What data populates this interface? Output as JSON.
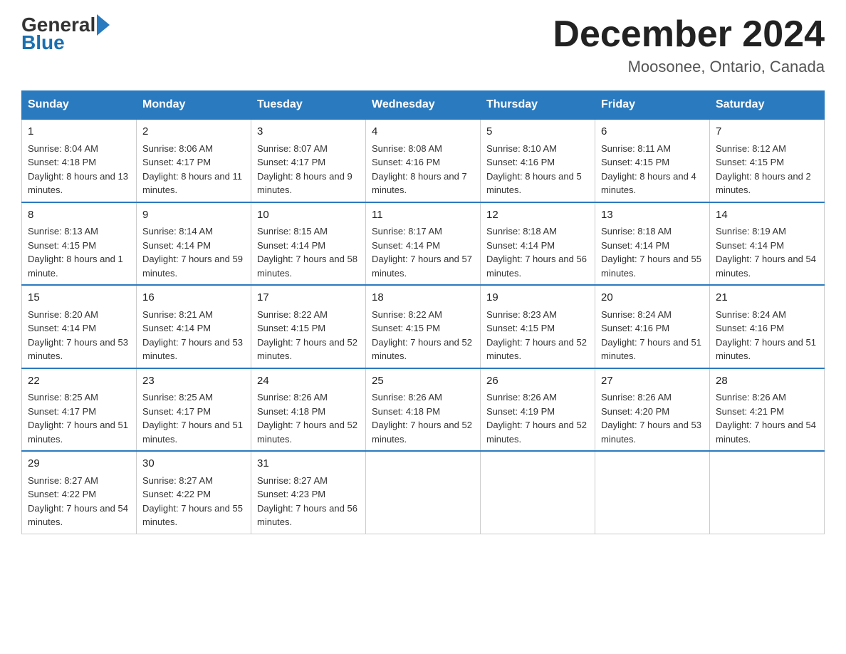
{
  "header": {
    "logo_general": "General",
    "logo_blue": "Blue",
    "title": "December 2024",
    "location": "Moosonee, Ontario, Canada"
  },
  "weekdays": [
    "Sunday",
    "Monday",
    "Tuesday",
    "Wednesday",
    "Thursday",
    "Friday",
    "Saturday"
  ],
  "weeks": [
    [
      {
        "day": "1",
        "sunrise": "8:04 AM",
        "sunset": "4:18 PM",
        "daylight": "8 hours and 13 minutes."
      },
      {
        "day": "2",
        "sunrise": "8:06 AM",
        "sunset": "4:17 PM",
        "daylight": "8 hours and 11 minutes."
      },
      {
        "day": "3",
        "sunrise": "8:07 AM",
        "sunset": "4:17 PM",
        "daylight": "8 hours and 9 minutes."
      },
      {
        "day": "4",
        "sunrise": "8:08 AM",
        "sunset": "4:16 PM",
        "daylight": "8 hours and 7 minutes."
      },
      {
        "day": "5",
        "sunrise": "8:10 AM",
        "sunset": "4:16 PM",
        "daylight": "8 hours and 5 minutes."
      },
      {
        "day": "6",
        "sunrise": "8:11 AM",
        "sunset": "4:15 PM",
        "daylight": "8 hours and 4 minutes."
      },
      {
        "day": "7",
        "sunrise": "8:12 AM",
        "sunset": "4:15 PM",
        "daylight": "8 hours and 2 minutes."
      }
    ],
    [
      {
        "day": "8",
        "sunrise": "8:13 AM",
        "sunset": "4:15 PM",
        "daylight": "8 hours and 1 minute."
      },
      {
        "day": "9",
        "sunrise": "8:14 AM",
        "sunset": "4:14 PM",
        "daylight": "7 hours and 59 minutes."
      },
      {
        "day": "10",
        "sunrise": "8:15 AM",
        "sunset": "4:14 PM",
        "daylight": "7 hours and 58 minutes."
      },
      {
        "day": "11",
        "sunrise": "8:17 AM",
        "sunset": "4:14 PM",
        "daylight": "7 hours and 57 minutes."
      },
      {
        "day": "12",
        "sunrise": "8:18 AM",
        "sunset": "4:14 PM",
        "daylight": "7 hours and 56 minutes."
      },
      {
        "day": "13",
        "sunrise": "8:18 AM",
        "sunset": "4:14 PM",
        "daylight": "7 hours and 55 minutes."
      },
      {
        "day": "14",
        "sunrise": "8:19 AM",
        "sunset": "4:14 PM",
        "daylight": "7 hours and 54 minutes."
      }
    ],
    [
      {
        "day": "15",
        "sunrise": "8:20 AM",
        "sunset": "4:14 PM",
        "daylight": "7 hours and 53 minutes."
      },
      {
        "day": "16",
        "sunrise": "8:21 AM",
        "sunset": "4:14 PM",
        "daylight": "7 hours and 53 minutes."
      },
      {
        "day": "17",
        "sunrise": "8:22 AM",
        "sunset": "4:15 PM",
        "daylight": "7 hours and 52 minutes."
      },
      {
        "day": "18",
        "sunrise": "8:22 AM",
        "sunset": "4:15 PM",
        "daylight": "7 hours and 52 minutes."
      },
      {
        "day": "19",
        "sunrise": "8:23 AM",
        "sunset": "4:15 PM",
        "daylight": "7 hours and 52 minutes."
      },
      {
        "day": "20",
        "sunrise": "8:24 AM",
        "sunset": "4:16 PM",
        "daylight": "7 hours and 51 minutes."
      },
      {
        "day": "21",
        "sunrise": "8:24 AM",
        "sunset": "4:16 PM",
        "daylight": "7 hours and 51 minutes."
      }
    ],
    [
      {
        "day": "22",
        "sunrise": "8:25 AM",
        "sunset": "4:17 PM",
        "daylight": "7 hours and 51 minutes."
      },
      {
        "day": "23",
        "sunrise": "8:25 AM",
        "sunset": "4:17 PM",
        "daylight": "7 hours and 51 minutes."
      },
      {
        "day": "24",
        "sunrise": "8:26 AM",
        "sunset": "4:18 PM",
        "daylight": "7 hours and 52 minutes."
      },
      {
        "day": "25",
        "sunrise": "8:26 AM",
        "sunset": "4:18 PM",
        "daylight": "7 hours and 52 minutes."
      },
      {
        "day": "26",
        "sunrise": "8:26 AM",
        "sunset": "4:19 PM",
        "daylight": "7 hours and 52 minutes."
      },
      {
        "day": "27",
        "sunrise": "8:26 AM",
        "sunset": "4:20 PM",
        "daylight": "7 hours and 53 minutes."
      },
      {
        "day": "28",
        "sunrise": "8:26 AM",
        "sunset": "4:21 PM",
        "daylight": "7 hours and 54 minutes."
      }
    ],
    [
      {
        "day": "29",
        "sunrise": "8:27 AM",
        "sunset": "4:22 PM",
        "daylight": "7 hours and 54 minutes."
      },
      {
        "day": "30",
        "sunrise": "8:27 AM",
        "sunset": "4:22 PM",
        "daylight": "7 hours and 55 minutes."
      },
      {
        "day": "31",
        "sunrise": "8:27 AM",
        "sunset": "4:23 PM",
        "daylight": "7 hours and 56 minutes."
      },
      null,
      null,
      null,
      null
    ]
  ],
  "labels": {
    "sunrise": "Sunrise:",
    "sunset": "Sunset:",
    "daylight": "Daylight:"
  }
}
